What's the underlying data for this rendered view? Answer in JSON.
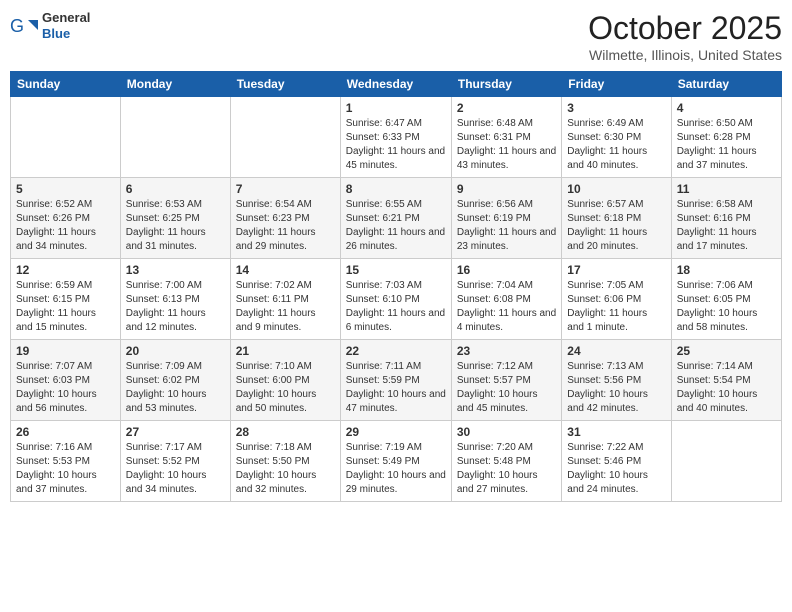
{
  "header": {
    "logo": {
      "general": "General",
      "blue": "Blue"
    },
    "title": "October 2025",
    "location": "Wilmette, Illinois, United States"
  },
  "weekdays": [
    "Sunday",
    "Monday",
    "Tuesday",
    "Wednesday",
    "Thursday",
    "Friday",
    "Saturday"
  ],
  "weeks": [
    [
      {
        "day": "",
        "sunrise": "",
        "sunset": "",
        "daylight": ""
      },
      {
        "day": "",
        "sunrise": "",
        "sunset": "",
        "daylight": ""
      },
      {
        "day": "",
        "sunrise": "",
        "sunset": "",
        "daylight": ""
      },
      {
        "day": "1",
        "sunrise": "Sunrise: 6:47 AM",
        "sunset": "Sunset: 6:33 PM",
        "daylight": "Daylight: 11 hours and 45 minutes."
      },
      {
        "day": "2",
        "sunrise": "Sunrise: 6:48 AM",
        "sunset": "Sunset: 6:31 PM",
        "daylight": "Daylight: 11 hours and 43 minutes."
      },
      {
        "day": "3",
        "sunrise": "Sunrise: 6:49 AM",
        "sunset": "Sunset: 6:30 PM",
        "daylight": "Daylight: 11 hours and 40 minutes."
      },
      {
        "day": "4",
        "sunrise": "Sunrise: 6:50 AM",
        "sunset": "Sunset: 6:28 PM",
        "daylight": "Daylight: 11 hours and 37 minutes."
      }
    ],
    [
      {
        "day": "5",
        "sunrise": "Sunrise: 6:52 AM",
        "sunset": "Sunset: 6:26 PM",
        "daylight": "Daylight: 11 hours and 34 minutes."
      },
      {
        "day": "6",
        "sunrise": "Sunrise: 6:53 AM",
        "sunset": "Sunset: 6:25 PM",
        "daylight": "Daylight: 11 hours and 31 minutes."
      },
      {
        "day": "7",
        "sunrise": "Sunrise: 6:54 AM",
        "sunset": "Sunset: 6:23 PM",
        "daylight": "Daylight: 11 hours and 29 minutes."
      },
      {
        "day": "8",
        "sunrise": "Sunrise: 6:55 AM",
        "sunset": "Sunset: 6:21 PM",
        "daylight": "Daylight: 11 hours and 26 minutes."
      },
      {
        "day": "9",
        "sunrise": "Sunrise: 6:56 AM",
        "sunset": "Sunset: 6:19 PM",
        "daylight": "Daylight: 11 hours and 23 minutes."
      },
      {
        "day": "10",
        "sunrise": "Sunrise: 6:57 AM",
        "sunset": "Sunset: 6:18 PM",
        "daylight": "Daylight: 11 hours and 20 minutes."
      },
      {
        "day": "11",
        "sunrise": "Sunrise: 6:58 AM",
        "sunset": "Sunset: 6:16 PM",
        "daylight": "Daylight: 11 hours and 17 minutes."
      }
    ],
    [
      {
        "day": "12",
        "sunrise": "Sunrise: 6:59 AM",
        "sunset": "Sunset: 6:15 PM",
        "daylight": "Daylight: 11 hours and 15 minutes."
      },
      {
        "day": "13",
        "sunrise": "Sunrise: 7:00 AM",
        "sunset": "Sunset: 6:13 PM",
        "daylight": "Daylight: 11 hours and 12 minutes."
      },
      {
        "day": "14",
        "sunrise": "Sunrise: 7:02 AM",
        "sunset": "Sunset: 6:11 PM",
        "daylight": "Daylight: 11 hours and 9 minutes."
      },
      {
        "day": "15",
        "sunrise": "Sunrise: 7:03 AM",
        "sunset": "Sunset: 6:10 PM",
        "daylight": "Daylight: 11 hours and 6 minutes."
      },
      {
        "day": "16",
        "sunrise": "Sunrise: 7:04 AM",
        "sunset": "Sunset: 6:08 PM",
        "daylight": "Daylight: 11 hours and 4 minutes."
      },
      {
        "day": "17",
        "sunrise": "Sunrise: 7:05 AM",
        "sunset": "Sunset: 6:06 PM",
        "daylight": "Daylight: 11 hours and 1 minute."
      },
      {
        "day": "18",
        "sunrise": "Sunrise: 7:06 AM",
        "sunset": "Sunset: 6:05 PM",
        "daylight": "Daylight: 10 hours and 58 minutes."
      }
    ],
    [
      {
        "day": "19",
        "sunrise": "Sunrise: 7:07 AM",
        "sunset": "Sunset: 6:03 PM",
        "daylight": "Daylight: 10 hours and 56 minutes."
      },
      {
        "day": "20",
        "sunrise": "Sunrise: 7:09 AM",
        "sunset": "Sunset: 6:02 PM",
        "daylight": "Daylight: 10 hours and 53 minutes."
      },
      {
        "day": "21",
        "sunrise": "Sunrise: 7:10 AM",
        "sunset": "Sunset: 6:00 PM",
        "daylight": "Daylight: 10 hours and 50 minutes."
      },
      {
        "day": "22",
        "sunrise": "Sunrise: 7:11 AM",
        "sunset": "Sunset: 5:59 PM",
        "daylight": "Daylight: 10 hours and 47 minutes."
      },
      {
        "day": "23",
        "sunrise": "Sunrise: 7:12 AM",
        "sunset": "Sunset: 5:57 PM",
        "daylight": "Daylight: 10 hours and 45 minutes."
      },
      {
        "day": "24",
        "sunrise": "Sunrise: 7:13 AM",
        "sunset": "Sunset: 5:56 PM",
        "daylight": "Daylight: 10 hours and 42 minutes."
      },
      {
        "day": "25",
        "sunrise": "Sunrise: 7:14 AM",
        "sunset": "Sunset: 5:54 PM",
        "daylight": "Daylight: 10 hours and 40 minutes."
      }
    ],
    [
      {
        "day": "26",
        "sunrise": "Sunrise: 7:16 AM",
        "sunset": "Sunset: 5:53 PM",
        "daylight": "Daylight: 10 hours and 37 minutes."
      },
      {
        "day": "27",
        "sunrise": "Sunrise: 7:17 AM",
        "sunset": "Sunset: 5:52 PM",
        "daylight": "Daylight: 10 hours and 34 minutes."
      },
      {
        "day": "28",
        "sunrise": "Sunrise: 7:18 AM",
        "sunset": "Sunset: 5:50 PM",
        "daylight": "Daylight: 10 hours and 32 minutes."
      },
      {
        "day": "29",
        "sunrise": "Sunrise: 7:19 AM",
        "sunset": "Sunset: 5:49 PM",
        "daylight": "Daylight: 10 hours and 29 minutes."
      },
      {
        "day": "30",
        "sunrise": "Sunrise: 7:20 AM",
        "sunset": "Sunset: 5:48 PM",
        "daylight": "Daylight: 10 hours and 27 minutes."
      },
      {
        "day": "31",
        "sunrise": "Sunrise: 7:22 AM",
        "sunset": "Sunset: 5:46 PM",
        "daylight": "Daylight: 10 hours and 24 minutes."
      },
      {
        "day": "",
        "sunrise": "",
        "sunset": "",
        "daylight": ""
      }
    ]
  ]
}
